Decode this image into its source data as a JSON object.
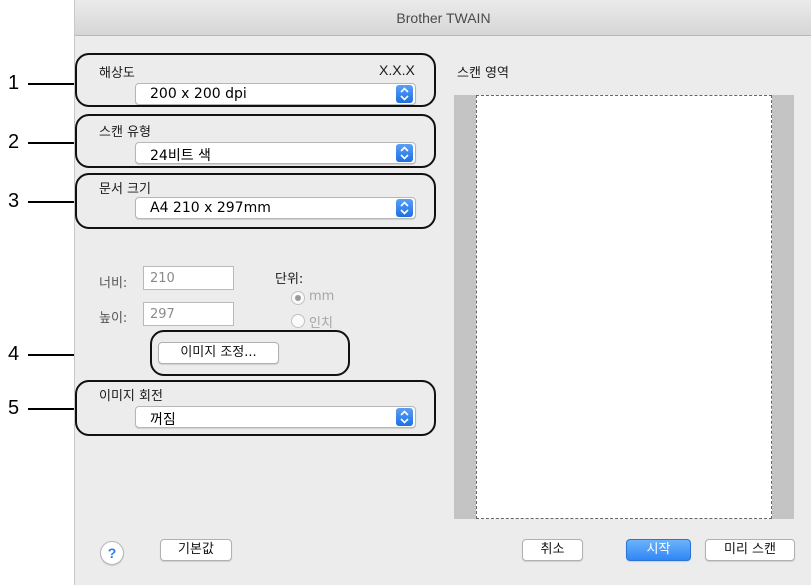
{
  "window": {
    "title": "Brother TWAIN"
  },
  "callouts": [
    "1",
    "2",
    "3",
    "4",
    "5"
  ],
  "resolution": {
    "label": "해상도",
    "version": "X.X.X",
    "value": "200 x 200 dpi"
  },
  "scan_type": {
    "label": "스캔 유형",
    "value": "24비트 색"
  },
  "doc_size": {
    "label": "문서 크기",
    "value": "A4  210 x 297mm"
  },
  "dimensions": {
    "width_label": "너비:",
    "width_value": "210",
    "height_label": "높이:",
    "height_value": "297",
    "unit_label": "단위:",
    "unit_mm": "mm",
    "unit_inch": "인치",
    "selected_unit": "mm"
  },
  "image_adjust_button": "이미지 조정...",
  "rotation": {
    "label": "이미지 회전",
    "value": "꺼짐"
  },
  "scan_area": {
    "label": "스캔 영역"
  },
  "footer": {
    "help": "?",
    "default_button": "기본값",
    "cancel_button": "취소",
    "start_button": "시작",
    "prescan_button": "미리 스캔"
  },
  "colors": {
    "accent": "#2f86f6"
  }
}
